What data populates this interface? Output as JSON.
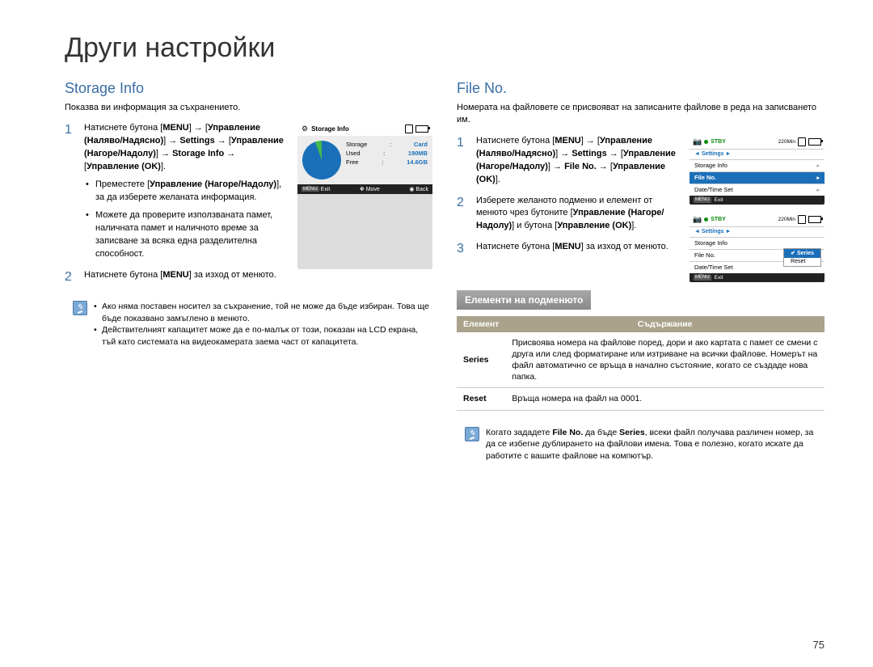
{
  "page": {
    "title": "Други настройки",
    "number": "75"
  },
  "left": {
    "heading": "Storage Info",
    "intro": "Показва ви информация за съхранението.",
    "step1_prefix": "Натиснете бутона [",
    "step1_menu": "MENU",
    "step1_arrow": "] → [",
    "step1_b1": "Управление (Наляво/Надясно)",
    "step1_arrow2": "] → ",
    "step1_b2": "Settings",
    "step1_arrow3": " → [",
    "step1_b3": "Управление (Нагоре/Надолу)",
    "step1_arrow4": "] → ",
    "step1_b4": "Storage Info",
    "step1_arrow5": " → [",
    "step1_b5": "Управление (OK)",
    "step1_suffix": "].",
    "sub1_a": "Преместете [",
    "sub1_b": "Управление (Нагоре/Надолу)",
    "sub1_c": "], за да изберете желаната информация.",
    "sub2": "Можете да проверите използваната памет, наличната памет и наличното време за записване за всяка една разделителна способност.",
    "step2_a": "Натиснете бутона [",
    "step2_b": "MENU",
    "step2_c": "] за изход от менюто.",
    "note1": "Ако няма поставен носител за съхранение, той не може да бъде избиран. Това ще бъде показвано замъглено в менюто.",
    "note2": "Действителният капацитет може да е по-малък от този, показан на LCD екрана, тъй като системата на видеокамерата заема част от капацитета.",
    "lcd": {
      "title": "Storage Info",
      "storage_l": "Storage",
      "storage_v": "Card",
      "used_l": "Used",
      "used_v": "190MB",
      "free_l": "Free",
      "free_v": "14.6GB",
      "exit": "Exit",
      "move": "Move",
      "back": "Back",
      "menu_tag": "MENU"
    }
  },
  "right": {
    "heading": "File No.",
    "intro": "Номерата на файловете се присвояват на записаните файлове в реда на записването им.",
    "step1_a": "Натиснете бутона [",
    "step1_m": "MENU",
    "step1_b": "] → [",
    "step1_c": "Управление (Наляво/Надясно)",
    "step1_d": "] → ",
    "step1_e": "Settings",
    "step1_f": " → [",
    "step1_g": "Управление (Нагоре/Надолу)",
    "step1_h": "] → ",
    "step1_i": "File No.",
    "step1_j": " → [",
    "step1_k": "Управление (OK)",
    "step1_l": "].",
    "step2": "Изберете желаното подменю и елемент от менюто чрез бутоните [",
    "step2b": "Управление (Нагоре/Надолу)",
    "step2c": "] и бутона [",
    "step2d": "Управление (OK)",
    "step2e": "].",
    "step3a": "Натиснете бутона [",
    "step3b": "MENU",
    "step3c": "] за изход от менюто.",
    "sub_heading": "Елементи на подменюто",
    "th1": "Елемент",
    "th2": "Съдържание",
    "row1_name": "Series",
    "row1_desc": "Присвоява номера на файлове поред, дори и ако картата с памет се смени с друга или след форматиране или изтриване на всички файлове. Номерът на файл автоматично се връща в начално състояние, когато се създаде нова папка.",
    "row2_name": "Reset",
    "row2_desc": "Връща номера на файл на 0001.",
    "note_a": "Когато зададете ",
    "note_b": "File No.",
    "note_c": " да бъде ",
    "note_d": "Series",
    "note_e": ", всеки файл получава различен номер, за да се избегне дублирането на файлови имена. Това е полезно, когато искате да работите с вашите файлове на компютър.",
    "lcd_top": {
      "stby": "STBY",
      "min": "220Min",
      "settings": "Settings",
      "storage": "Storage Info",
      "file_no": "File No.",
      "datetime": "Date/Time Set",
      "exit": "Exit",
      "menu_tag": "MENU"
    },
    "lcd_bot": {
      "stby": "STBY",
      "min": "220Min",
      "settings": "Settings",
      "storage": "Storage Info",
      "file_no": "File No.",
      "datetime": "Date/Time Set",
      "series": "Series",
      "reset": "Reset",
      "exit": "Exit",
      "menu_tag": "MENU"
    }
  }
}
